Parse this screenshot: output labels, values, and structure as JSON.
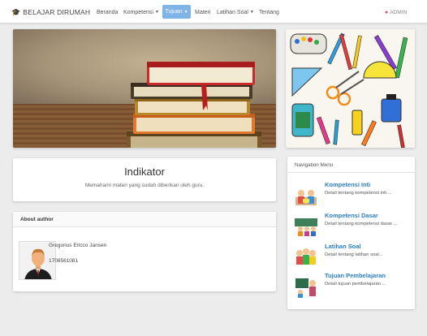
{
  "navbar": {
    "brand": "BELAJAR DIRUMAH",
    "brand_icon": "graduation-cap-icon",
    "items": [
      {
        "label": "Beranda"
      },
      {
        "label": "Kompetensi",
        "dropdown": true
      },
      {
        "label": "Tujuan",
        "dropdown": true,
        "active": true
      },
      {
        "label": "Materi"
      },
      {
        "label": "Latihan Soal",
        "dropdown": true
      },
      {
        "label": "Tentang"
      }
    ],
    "user_label": "ADMIN",
    "user_icon": "user-icon",
    "accent_color": "#7fb4e8"
  },
  "indikator": {
    "title": "Indikator",
    "description": "Memahami materi yang sudah diberikan oleh guru."
  },
  "about": {
    "heading": "About author",
    "name": "Gregorius Ericco Jansen",
    "nim": "1708561081"
  },
  "nav_menu": {
    "heading": "Navigation Menu",
    "items": [
      {
        "title": "Kompetensi Inti",
        "description": "Detail tentang kompetensi inti ..."
      },
      {
        "title": "Kompetensi Dasar",
        "description": "Detail tentang kompetensi dasar ..."
      },
      {
        "title": "Latihan Soal",
        "description": "Detail tentang latihan soal..."
      },
      {
        "title": "Tujuan Pembelajaran",
        "description": "Detail tujuan pembelajaran ..."
      }
    ],
    "title_color": "#2a7fc4"
  }
}
